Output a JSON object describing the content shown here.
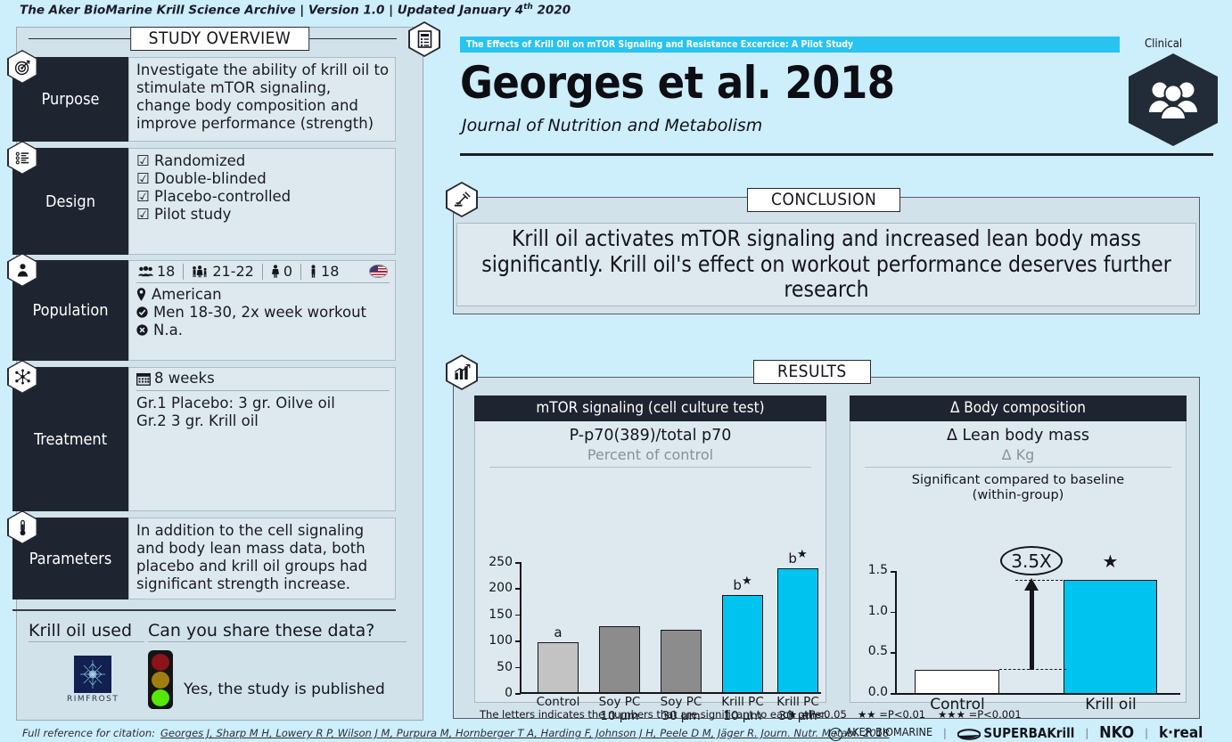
{
  "archive": {
    "text_before": "The Aker BioMarine Krill Science Archive | Version 1.0 | Updated January 4",
    "sup": "th",
    "text_after": " 2020"
  },
  "left_panel": {
    "title": "STUDY OVERVIEW",
    "doc_icon": "document-icon",
    "rows": [
      {
        "key": "purpose",
        "label": "Purpose",
        "icon": "target-icon",
        "body": "Investigate the ability of krill oil to stimulate mTOR signaling, change body composition and improve performance (strength)"
      },
      {
        "key": "design",
        "label": "Design",
        "icon": "checklist-icon",
        "items": [
          "Randomized",
          "Double-blinded",
          "Placebo-controlled",
          "Pilot study"
        ]
      },
      {
        "key": "population",
        "label": "Population",
        "icon": "person-icon",
        "stats": {
          "participants": "18",
          "age_range": "21-22",
          "women": "0",
          "men": "18",
          "flag": "us-flag"
        },
        "lines": [
          {
            "icon": "location-pin-icon",
            "text": "American"
          },
          {
            "icon": "check-circle-icon",
            "text": "Men 18-30, 2x week workout"
          },
          {
            "icon": "x-circle-icon",
            "text": "N.a."
          }
        ]
      },
      {
        "key": "treatment",
        "label": "Treatment",
        "icon": "molecule-icon",
        "duration_icon": "calendar-icon",
        "duration": "8 weeks",
        "groups": [
          "Gr.1  Placebo: 3 gr. Oilve oil",
          "Gr.2  3 gr. Krill oil"
        ]
      },
      {
        "key": "parameters",
        "label": "Parameters",
        "icon": "thermometer-icon",
        "body": "In addition to the cell signaling and body lean mass data, both placebo and krill oil groups had significant strength increase."
      }
    ],
    "krill_oil_used_heading": "Krill oil used",
    "krill_oil_brand": "RIMFROST",
    "share_heading": "Can you share these data?",
    "share_answer": "Yes, the study is published",
    "traffic_light": {
      "red": "#8a1418",
      "yellow": "#a07d10",
      "green": "#55e800"
    }
  },
  "header": {
    "study_bar": "The Effects of Krill Oil on mTOR Signaling and Resistance Excercice: A Pilot Study",
    "title": "Georges et al. 2018",
    "journal": "Journal of Nutrition and Metabolism",
    "badge_label": "Clinical",
    "badge_icon": "people-group-icon",
    "bar_color": "#29c3f0"
  },
  "conclusion": {
    "section_title": "CONCLUSION",
    "icon": "gavel-icon",
    "text": "Krill oil activates mTOR signaling and increased lean body mass significantly. Krill oil's effect on workout performance deserves further research"
  },
  "results": {
    "section_title": "RESULTS",
    "icon": "bar-chart-icon",
    "footnote_left": "The letters indicates the numbers that are significant to each other.",
    "footnote_stars": [
      "★ =P<0.05",
      "★★ =P<0.01",
      "★★★ =P<0.001"
    ]
  },
  "chart_data": [
    {
      "type": "bar",
      "panel_title": "mTOR signaling (cell culture test)",
      "title": "P-p70(389)/total p70",
      "subtitle": "Percent of control",
      "ylabel": "",
      "xlabel": "",
      "ylim": [
        0,
        250
      ],
      "yticks": [
        0,
        50,
        100,
        150,
        200,
        250
      ],
      "categories": [
        "Control",
        "Soy PC\n10 µm",
        "Soy PC\n30 µm",
        "Krill PC\n10 µm",
        "Krill PC\n30 µm"
      ],
      "category_lines": [
        [
          "Control",
          ""
        ],
        [
          "Soy PC",
          "10 µm"
        ],
        [
          "Soy PC",
          "30 µm"
        ],
        [
          "Krill PC",
          "10 µm"
        ],
        [
          "Krill PC",
          "30 µm"
        ]
      ],
      "values": [
        97,
        127,
        121,
        188,
        238
      ],
      "colors": [
        "#c3c3c3",
        "#8c8c8c",
        "#8c8c8c",
        "#00c4f0",
        "#00c4f0"
      ],
      "annotations": [
        "a",
        "",
        "",
        "b★",
        "b★"
      ],
      "grid": false,
      "legend": "none"
    },
    {
      "type": "bar",
      "panel_title": "Δ Body composition",
      "title": "Δ Lean body mass",
      "subtitle": "Δ Kg",
      "note": "Significant compared to baseline\n(within-group)",
      "ylabel": "",
      "xlabel": "",
      "ylim": [
        0.0,
        1.5
      ],
      "yticks": [
        0.0,
        0.5,
        1.0,
        1.5
      ],
      "ytick_labels": [
        "0.0",
        "0.5",
        "1.0",
        "1.5"
      ],
      "categories": [
        "Control",
        "Krill oil"
      ],
      "values": [
        0.3,
        1.4
      ],
      "colors": [
        "#ffffff",
        "#00c4f0"
      ],
      "annotations": [
        "",
        "★"
      ],
      "fold_change": "3.5X",
      "grid": false,
      "legend": "none"
    }
  ],
  "footer": {
    "label": "Full reference for citation:",
    "citation": "Georges J, Sharp M H, Lowery R P, Wilson J M, Purpura M, Hornberger T A, Harding F, Johnson J H, Peele D M, Jäger R. Journ. Nutr. Metabl. 2018",
    "brands": [
      "AKER BIOMARINE",
      "SUPERBAKrill",
      "NKO",
      "k·real"
    ]
  }
}
